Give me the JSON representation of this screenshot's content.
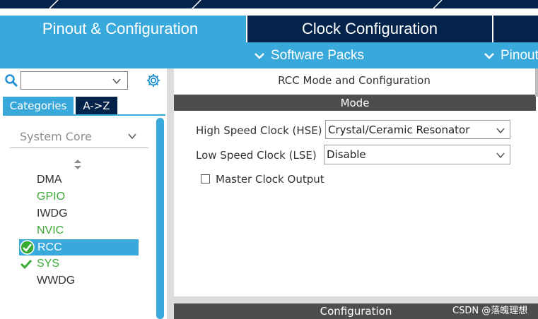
{
  "tabs": {
    "pinout": "Pinout & Configuration",
    "clock": "Clock Configuration"
  },
  "subbar": {
    "software_packs": "Software Packs",
    "pinout": "Pinout"
  },
  "left_panel": {
    "search_value": "",
    "categories_label": "Categories",
    "az_label": "A->Z",
    "group_label": "System Core",
    "peripherals": [
      {
        "name": "DMA",
        "status": "none"
      },
      {
        "name": "GPIO",
        "status": "configured"
      },
      {
        "name": "IWDG",
        "status": "none"
      },
      {
        "name": "NVIC",
        "status": "configured"
      },
      {
        "name": "RCC",
        "status": "selected"
      },
      {
        "name": "SYS",
        "status": "configured"
      },
      {
        "name": "WWDG",
        "status": "none"
      }
    ]
  },
  "right_panel": {
    "title": "RCC Mode and Configuration",
    "mode_header": "Mode",
    "hse_label": "High Speed Clock (HSE)",
    "hse_value": "Crystal/Ceramic Resonator",
    "lse_label": "Low Speed Clock (LSE)",
    "lse_value": "Disable",
    "mco_label": "Master Clock Output",
    "mco_checked": false,
    "config_header": "Configuration"
  },
  "watermark": "CSDN @落魄理想",
  "colors": {
    "accent_blue": "#39a9dc",
    "navy": "#03234b",
    "header_gray": "#4d4d4d",
    "configured_green": "#3aaa35"
  }
}
